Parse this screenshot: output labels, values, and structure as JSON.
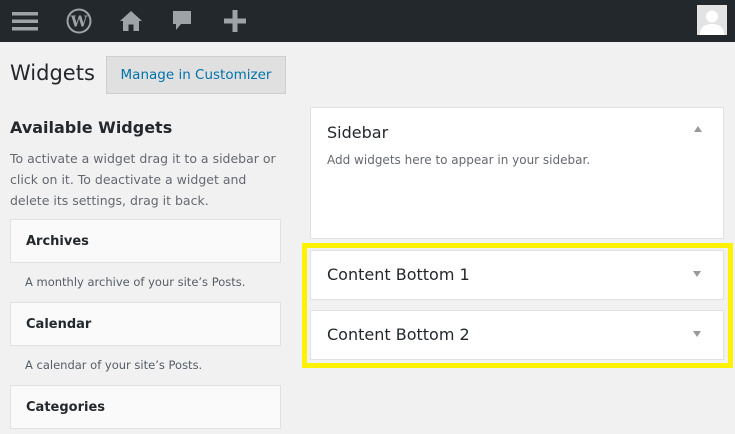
{
  "adminbar": {
    "icons": [
      "menu-icon",
      "wordpress-logo-icon",
      "home-icon",
      "comments-icon",
      "add-new-icon",
      "avatar-icon"
    ]
  },
  "header": {
    "title": "Widgets",
    "customizer_button": "Manage in Customizer"
  },
  "available": {
    "title": "Available Widgets",
    "description": "To activate a widget drag it to a sidebar or click on it. To deactivate a widget and delete its settings, drag it back.",
    "widgets": [
      {
        "name": "Archives",
        "description": "A monthly archive of your site’s Posts."
      },
      {
        "name": "Calendar",
        "description": "A calendar of your site’s Posts."
      },
      {
        "name": "Categories",
        "description": ""
      }
    ]
  },
  "sidebars": {
    "main": {
      "title": "Sidebar",
      "description": "Add widgets here to appear in your sidebar."
    },
    "areas": [
      {
        "title": "Content Bottom 1"
      },
      {
        "title": "Content Bottom 2"
      }
    ]
  },
  "colors": {
    "adminbar": "#23282d",
    "link": "#0073aa",
    "highlight": "#fff200"
  }
}
